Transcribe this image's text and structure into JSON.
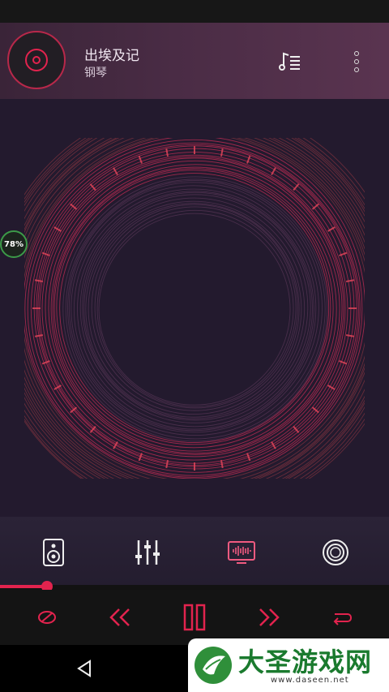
{
  "now_playing": {
    "title": "出埃及记",
    "artist": "钢琴"
  },
  "battery": {
    "label": "78%"
  },
  "effects": [
    {
      "name": "speaker-icon"
    },
    {
      "name": "equalizer-icon"
    },
    {
      "name": "visualizer-icon",
      "active": true
    },
    {
      "name": "surround-icon"
    }
  ],
  "progress": {
    "fraction": 0.12
  },
  "controls": [
    "shuffle-icon",
    "previous-icon",
    "pause-icon",
    "next-icon",
    "repeat-icon"
  ],
  "watermark": {
    "title": "大圣游戏网",
    "subtitle": "www.daseen.net"
  },
  "colors": {
    "accent": "#e2234e",
    "header": "#4a2c45",
    "background": "#231a2e"
  }
}
